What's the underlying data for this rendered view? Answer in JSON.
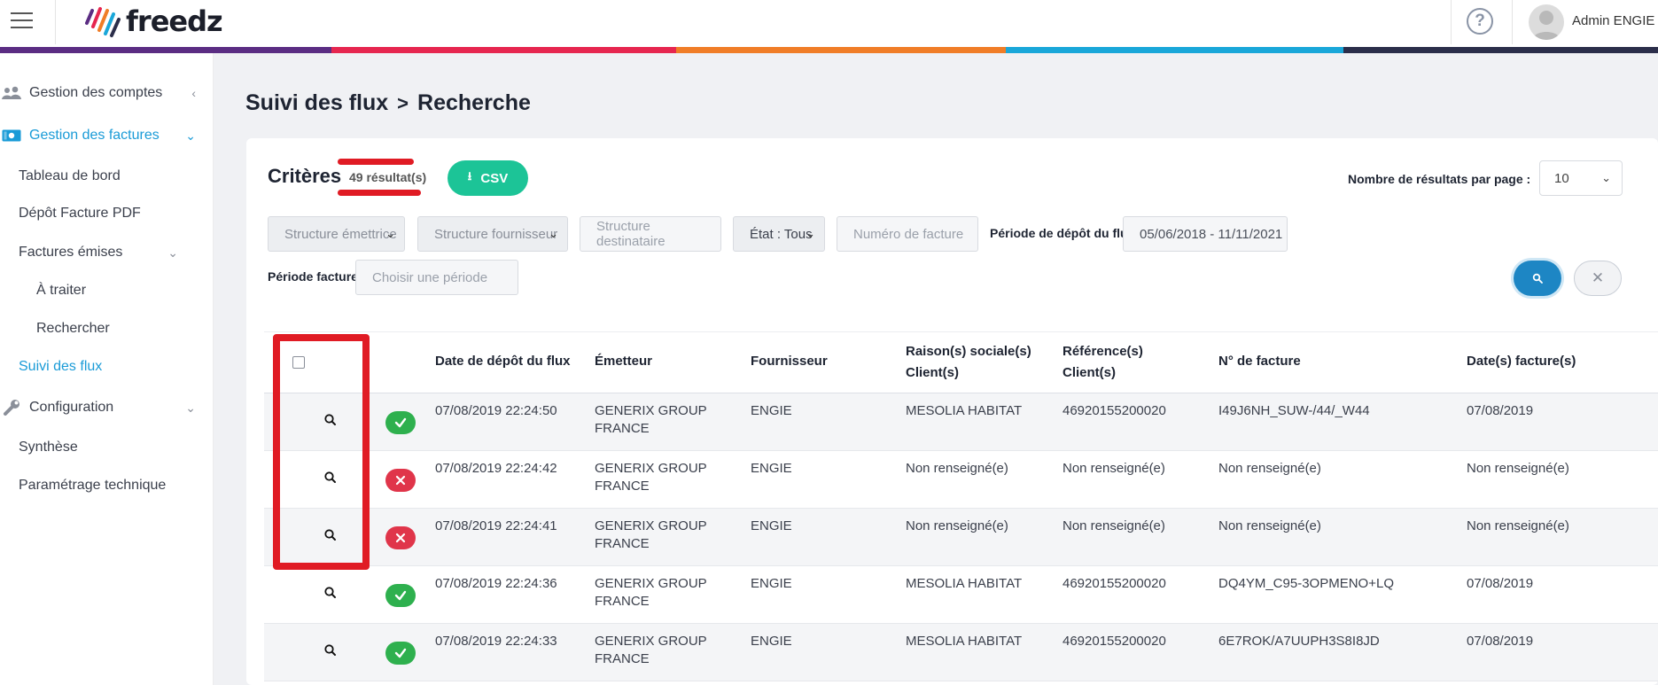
{
  "app": {
    "logo_text": "freedz",
    "help_icon": "question-circle-icon",
    "user_name": "Admin ENGIE",
    "brand_colors": [
      "#5b2d83",
      "#e6264f",
      "#f07d27",
      "#1aa7d9",
      "#2b2e4a"
    ]
  },
  "sidebar": {
    "items": [
      {
        "label": "Gestion des comptes",
        "icon": "users-icon",
        "chevron": "‹"
      },
      {
        "label": "Gestion des factures",
        "icon": "invoice-icon",
        "chevron": "⌄",
        "active": true
      },
      {
        "label": "Tableau de bord"
      },
      {
        "label": "Dépôt Facture PDF"
      },
      {
        "label": "Factures émises",
        "chevron": "⌄"
      },
      {
        "label": "À traiter"
      },
      {
        "label": "Rechercher"
      },
      {
        "label": "Suivi des flux",
        "active": true
      },
      {
        "label": "Configuration",
        "icon": "wrench-icon",
        "chevron": "⌄"
      },
      {
        "label": "Synthèse"
      },
      {
        "label": "Paramétrage technique"
      }
    ]
  },
  "page": {
    "breadcrumb_root": "Suivi des flux",
    "breadcrumb_sep": ">",
    "breadcrumb_current": "Recherche"
  },
  "criteria": {
    "title": "Critères",
    "result_count": "49 résultat(s)",
    "csv_label": "CSV",
    "per_page_label": "Nombre de résultats par page :",
    "per_page_value": "10",
    "structure_emettrice": "Structure émettrice",
    "structure_fournisseur": "Structure fournisseur",
    "structure_destinataire": "Structure destinataire",
    "etat": "État : Tous",
    "numero_facture": "Numéro de facture",
    "periode_depot_label": "Période de dépôt du flux :",
    "periode_depot_value": "05/06/2018 - 11/11/2021",
    "periode_facture_label": "Période facture :",
    "periode_facture_placeholder": "Choisir une période"
  },
  "table": {
    "headers": {
      "date_depot": "Date de dépôt du flux",
      "emetteur": "Émetteur",
      "fournisseur": "Fournisseur",
      "raison_sociale_1": "Raison(s) sociale(s)",
      "raison_sociale_2": "Client(s)",
      "reference_1": "Référence(s)",
      "reference_2": "Client(s)",
      "numero_facture": "N° de facture",
      "dates_facture": "Date(s) facture(s)"
    },
    "rows": [
      {
        "status": "ok",
        "date": "07/08/2019 22:24:50",
        "emetteur_1": "GENERIX GROUP",
        "emetteur_2": "FRANCE",
        "fournisseur": "ENGIE",
        "raison": "MESOLIA HABITAT",
        "reference": "46920155200020",
        "numero": "I49J6NH_SUW-/44/_W44",
        "date_facture": "07/08/2019"
      },
      {
        "status": "ko",
        "date": "07/08/2019 22:24:42",
        "emetteur_1": "GENERIX GROUP",
        "emetteur_2": "FRANCE",
        "fournisseur": "ENGIE",
        "raison": "Non renseigné(e)",
        "reference": "Non renseigné(e)",
        "numero": "Non renseigné(e)",
        "date_facture": "Non renseigné(e)"
      },
      {
        "status": "ko",
        "date": "07/08/2019 22:24:41",
        "emetteur_1": "GENERIX GROUP",
        "emetteur_2": "FRANCE",
        "fournisseur": "ENGIE",
        "raison": "Non renseigné(e)",
        "reference": "Non renseigné(e)",
        "numero": "Non renseigné(e)",
        "date_facture": "Non renseigné(e)"
      },
      {
        "status": "ok",
        "date": "07/08/2019 22:24:36",
        "emetteur_1": "GENERIX GROUP",
        "emetteur_2": "FRANCE",
        "fournisseur": "ENGIE",
        "raison": "MESOLIA HABITAT",
        "reference": "46920155200020",
        "numero": "DQ4YM_C95-3OPMENO+LQ",
        "date_facture": "07/08/2019"
      },
      {
        "status": "ok",
        "date": "07/08/2019 22:24:33",
        "emetteur_1": "GENERIX GROUP",
        "emetteur_2": "FRANCE",
        "fournisseur": "ENGIE",
        "raison": "MESOLIA HABITAT",
        "reference": "46920155200020",
        "numero": "6E7ROK/A7UUPH3S8I8JD",
        "date_facture": "07/08/2019"
      }
    ]
  }
}
